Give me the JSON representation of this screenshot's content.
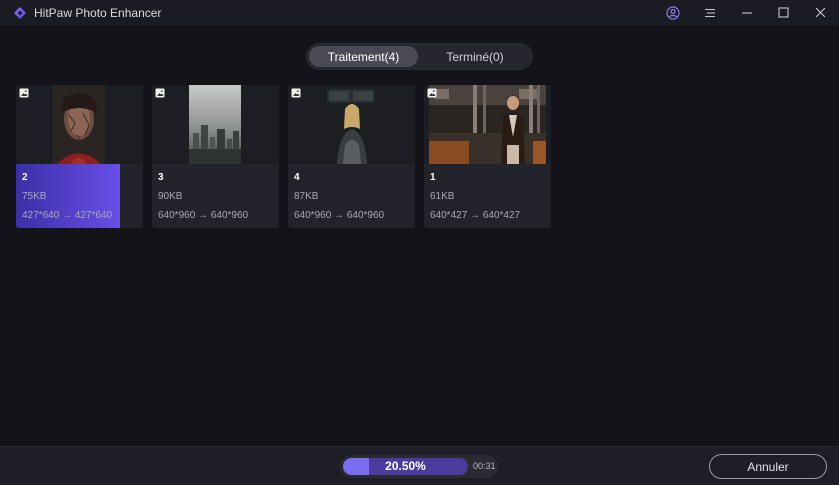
{
  "app": {
    "title": "HitPaw Photo Enhancer",
    "logo_icon": "hitpaw-logo-icon",
    "accent_color": "#7b6cf0"
  },
  "window_controls": {
    "account_icon": "user-circle-icon",
    "menu_icon": "menu-icon",
    "minimize_icon": "minimize-icon",
    "maximize_icon": "maximize-icon",
    "close_icon": "close-icon"
  },
  "tabs": [
    {
      "label": "Traitement(4)",
      "active": true
    },
    {
      "label": "Terminé(0)",
      "active": false
    }
  ],
  "cards": [
    {
      "name": "2",
      "size": "75KB",
      "resolution": "427*640 → 427*640",
      "progress_fraction": 0.205,
      "badge_icon": "image-icon"
    },
    {
      "name": "3",
      "size": "90KB",
      "resolution": "640*960 → 640*960",
      "badge_icon": "image-icon"
    },
    {
      "name": "4",
      "size": "87KB",
      "resolution": "640*960 → 640*960",
      "badge_icon": "image-icon"
    },
    {
      "name": "1",
      "size": "61KB",
      "resolution": "640*427 → 640*427",
      "badge_icon": "image-icon"
    }
  ],
  "footer": {
    "progress_label": "20.50%",
    "progress_fraction": 0.205,
    "elapsed_time": "00:31",
    "cancel_label": "Annuler"
  }
}
